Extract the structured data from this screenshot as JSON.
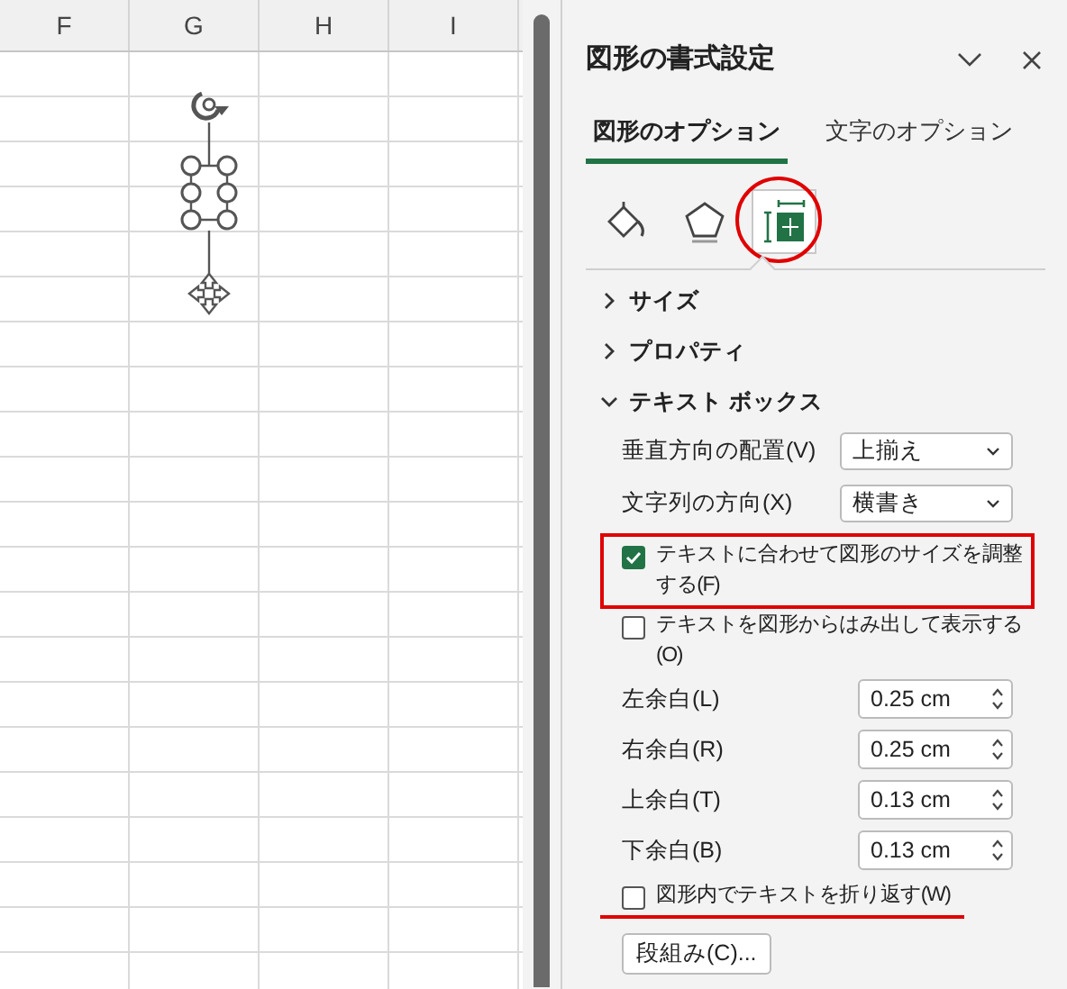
{
  "sheet": {
    "columns": [
      "F",
      "G",
      "H",
      "I"
    ]
  },
  "panel": {
    "title": "図形の書式設定",
    "tabs": [
      {
        "label": "図形のオプション",
        "selected": true
      },
      {
        "label": "文字のオプション",
        "selected": false
      }
    ],
    "icon_tabs": [
      {
        "kind": "fill",
        "selected": false,
        "circled": false
      },
      {
        "kind": "effects",
        "selected": false,
        "circled": false
      },
      {
        "kind": "size",
        "selected": true,
        "circled": true
      }
    ],
    "sections": [
      {
        "label": "サイズ",
        "expanded": false
      },
      {
        "label": "プロパティ",
        "expanded": false
      },
      {
        "label": "テキスト ボックス",
        "expanded": true
      }
    ],
    "dropdowns": [
      {
        "label": "垂直方向の配置(V)",
        "value": "上揃え"
      },
      {
        "label": "文字列の方向(X)",
        "value": "横書き"
      }
    ],
    "checkboxes": [
      {
        "label": "テキストに合わせて図形のサイズを調整する(F)",
        "checked": true,
        "boxed": true
      },
      {
        "label": "テキストを図形からはみ出して表示する(O)",
        "checked": false,
        "boxed": false
      }
    ],
    "margins": [
      {
        "label": "左余白(L)",
        "value": "0.25 cm"
      },
      {
        "label": "右余白(R)",
        "value": "0.25 cm"
      },
      {
        "label": "上余白(T)",
        "value": "0.13 cm"
      },
      {
        "label": "下余白(B)",
        "value": "0.13 cm"
      }
    ],
    "wrap_checkbox": {
      "label": "図形内でテキストを折り返す(W)",
      "checked": false,
      "underlined": true
    },
    "columns_button": "段組み(C)..."
  }
}
